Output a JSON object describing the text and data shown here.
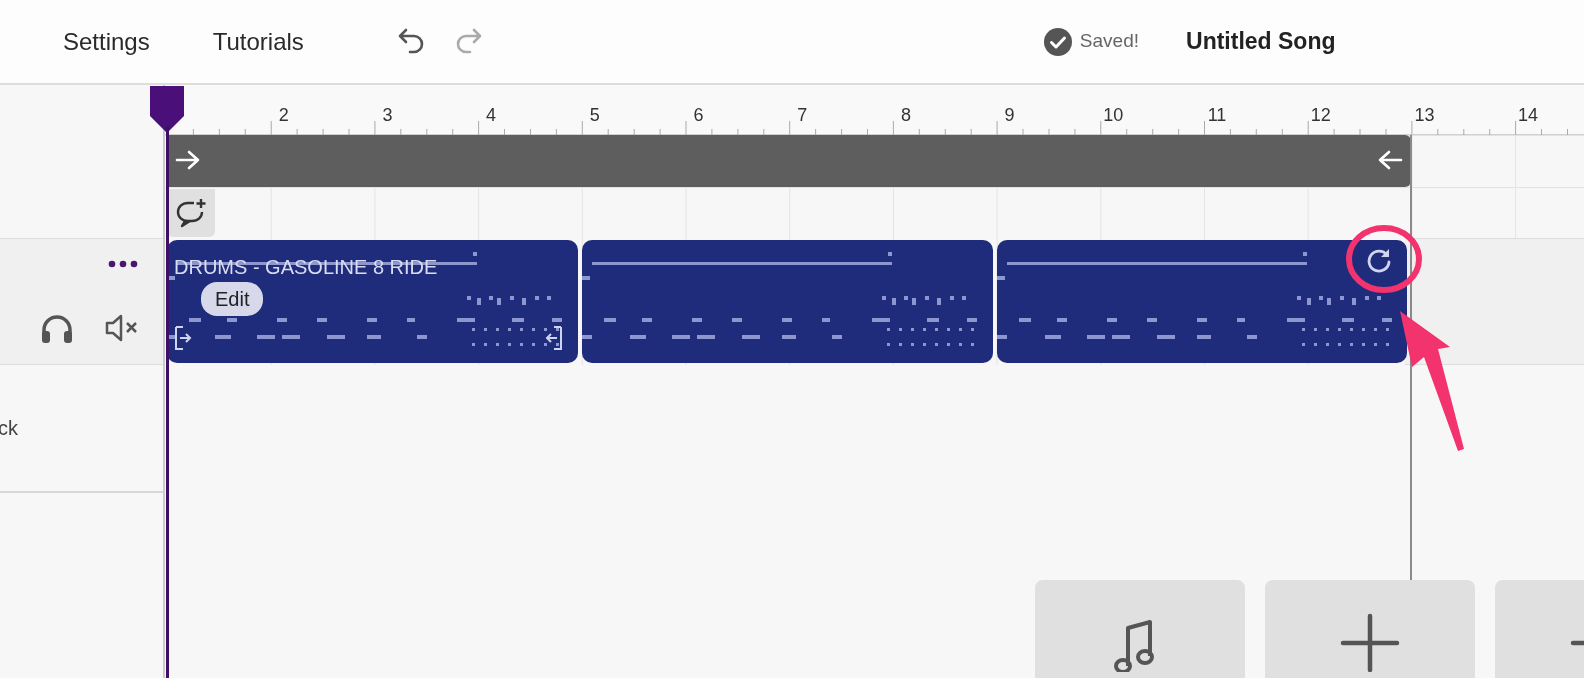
{
  "header": {
    "menu": [
      {
        "label": "Settings"
      },
      {
        "label": "Tutorials"
      }
    ],
    "undo": {
      "disabled": false
    },
    "redo": {
      "disabled": true
    },
    "save_status": "Saved!",
    "song_title": "Untitled Song"
  },
  "ruler": {
    "labels": [
      "2",
      "3",
      "4",
      "5",
      "6",
      "7",
      "8",
      "9",
      "10",
      "11",
      "12",
      "13",
      "14"
    ]
  },
  "sidebar_rows": [
    {
      "text": "ck"
    }
  ],
  "clips": [
    {
      "kind": "original",
      "title": "DRUMS - GASOLINE 8 RIDE",
      "edit_label": "Edit",
      "loop_handle": false
    },
    {
      "kind": "repeat",
      "loop_handle": false
    },
    {
      "kind": "repeat",
      "loop_handle": true
    }
  ],
  "add_buttons": [
    {
      "kind": "note"
    },
    {
      "kind": "add"
    },
    {
      "kind": "add"
    }
  ]
}
